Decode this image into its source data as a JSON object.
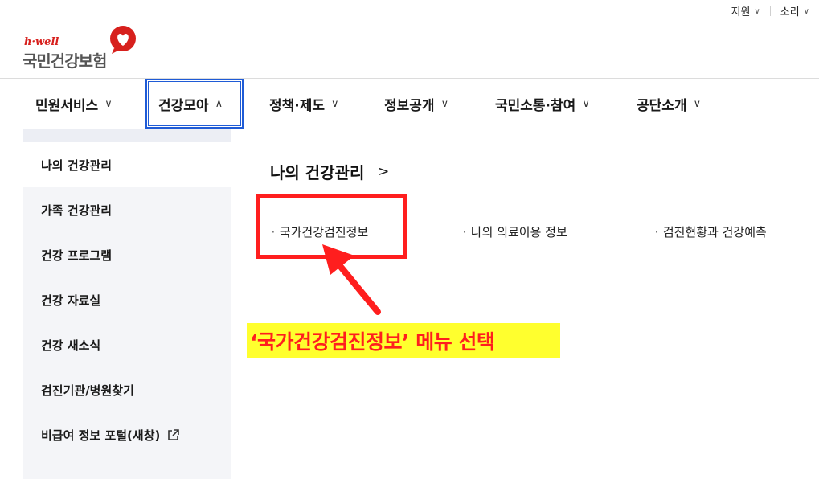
{
  "utility": {
    "support_label": "지원",
    "sound_label": "소리"
  },
  "logo": {
    "sub": "h·well",
    "main": "국민건강보험",
    "brand_red": "#d7201d"
  },
  "gnb": {
    "items": [
      {
        "label": "민원서비스",
        "chevron": "chevron-down-icon"
      },
      {
        "label": "건강모아",
        "chevron": "chevron-up-icon",
        "active": true
      },
      {
        "label": "정책·제도",
        "chevron": "chevron-down-icon"
      },
      {
        "label": "정보공개",
        "chevron": "chevron-down-icon"
      },
      {
        "label": "국민소통·참여",
        "chevron": "chevron-down-icon"
      },
      {
        "label": "공단소개",
        "chevron": "chevron-down-icon"
      }
    ],
    "active_border_color": "#1f5bd6"
  },
  "submenu": {
    "items": [
      {
        "label": "나의 건강관리",
        "selected": true
      },
      {
        "label": "가족 건강관리"
      },
      {
        "label": "건강 프로그램"
      },
      {
        "label": "건강 자료실"
      },
      {
        "label": "건강 새소식"
      },
      {
        "label": "검진기관/병원찾기"
      },
      {
        "label": "비급여 정보 포털(새창)",
        "icon": "external-link-icon"
      }
    ]
  },
  "content": {
    "heading": "나의 건강관리",
    "links": [
      "국가건강검진정보",
      "나의 의료이용 정보",
      "검진현황과 건강예측"
    ]
  },
  "annotation": {
    "callout_text": "‘국가건강검진정보’ 메뉴 선택",
    "highlight_color": "#ffff2e",
    "annotation_red": "#ff1e1e"
  }
}
